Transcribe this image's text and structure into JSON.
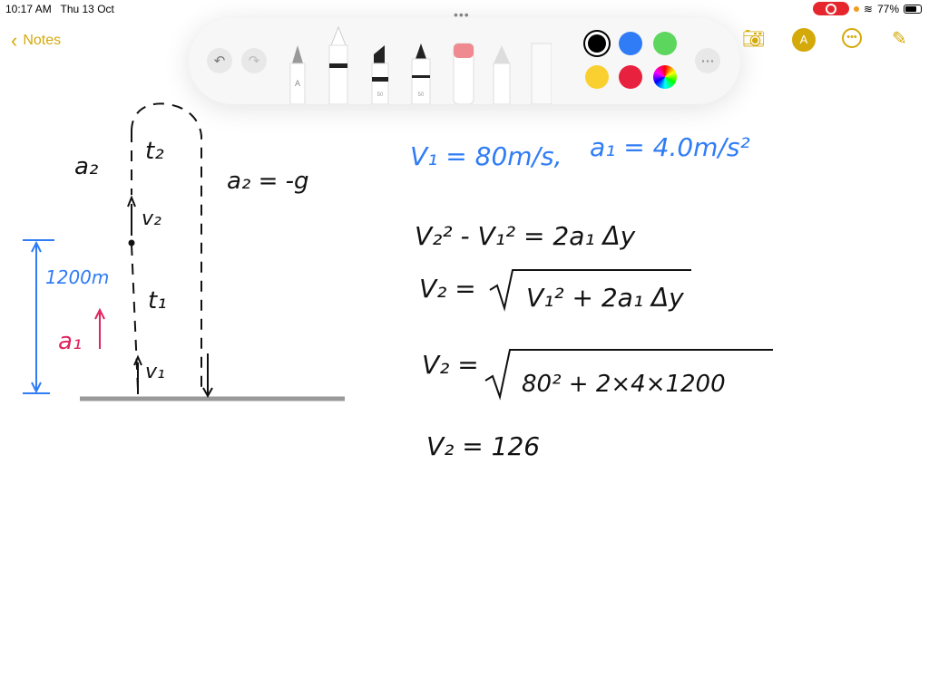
{
  "status": {
    "time": "10:17 AM",
    "date": "Thu 13 Oct",
    "battery": "77%",
    "battery_level": 0.77
  },
  "nav": {
    "back_label": "Notes",
    "back_icon": "chevron-left-icon"
  },
  "toolbar": {
    "tools": [
      "monoline-pencil",
      "pen",
      "marker",
      "fountain-pen",
      "eraser",
      "lasso",
      "ruler"
    ],
    "marker_label": "50",
    "fountain_label": "50",
    "pencil_label": "A",
    "colors": [
      "#000000",
      "#2f7cf6",
      "#5cd65c",
      "#f9d030",
      "#e8213f",
      "color-wheel"
    ],
    "selected_color": "#000000"
  },
  "header_icons": [
    "camera-icon",
    "markup-icon",
    "more-icon",
    "compose-icon"
  ],
  "colors": {
    "accent": "#d4a90a",
    "ink_blue": "#2f7cf6",
    "ink_red": "#e0245e",
    "ink_black": "#111111"
  },
  "drawing": {
    "a2_left": "a₂",
    "t2": "t₂",
    "a2_eq": "a₂ = -g",
    "v2": "v₂",
    "height": "1200m",
    "t1": "t₁",
    "a1": "a₁",
    "v1": "v₁"
  },
  "work": {
    "given_v1": "V₁ = 80m/s,",
    "given_a1": "a₁ = 4.0m/s²",
    "eq1": "V₂² - V₁² = 2a₁ Δy",
    "eq2_lhs": "V₂ =",
    "eq2_rhs": "V₁² + 2a₁ Δy",
    "eq3_lhs": "V₂ =",
    "eq3_rhs": "80² + 2×4×1200",
    "eq4": "V₂ = 126"
  }
}
